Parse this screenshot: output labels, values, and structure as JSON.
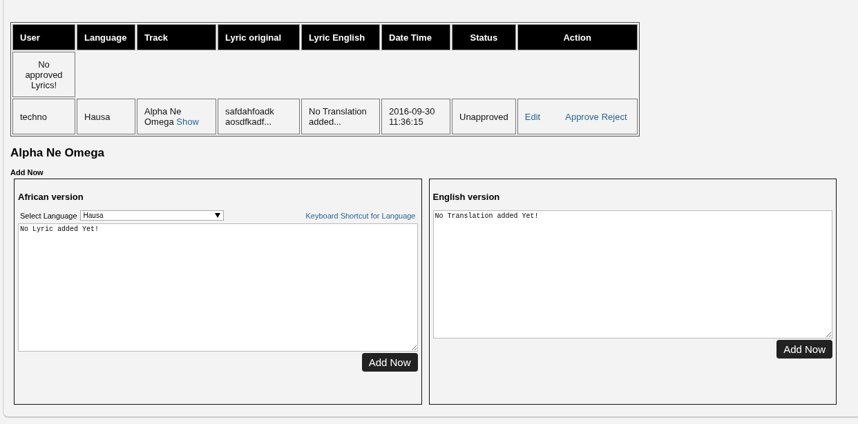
{
  "table": {
    "columns": [
      "User",
      "Language",
      "Track",
      "Lyric original",
      "Lyric English",
      "Date Time",
      "Status",
      "Action"
    ],
    "empty_message": "No approved Lyrics!",
    "rows": [
      {
        "user": "techno",
        "language": "Hausa",
        "track": "Alpha Ne Omega",
        "track_link": "Show",
        "lyric_original": "safdahfoadk aosdfkadf...",
        "lyric_english": "No Translation added...",
        "date_time": "2016-09-30 11:36:15",
        "status": "Unapproved",
        "actions": [
          "Edit",
          "Approve",
          "Reject"
        ]
      }
    ]
  },
  "track_title": "Alpha Ne Omega",
  "add_now_label": "Add Now",
  "panels": [
    {
      "kind": "african",
      "title": "African version",
      "select_label": "Select Language",
      "select_value": "Hausa",
      "shortcut_link": "Keyboard Shortcut for Language",
      "text": "No Lyric added Yet!",
      "button": "Add Now"
    },
    {
      "kind": "english",
      "title": "English version",
      "text": "No Translation added Yet!",
      "button": "Add Now"
    }
  ]
}
